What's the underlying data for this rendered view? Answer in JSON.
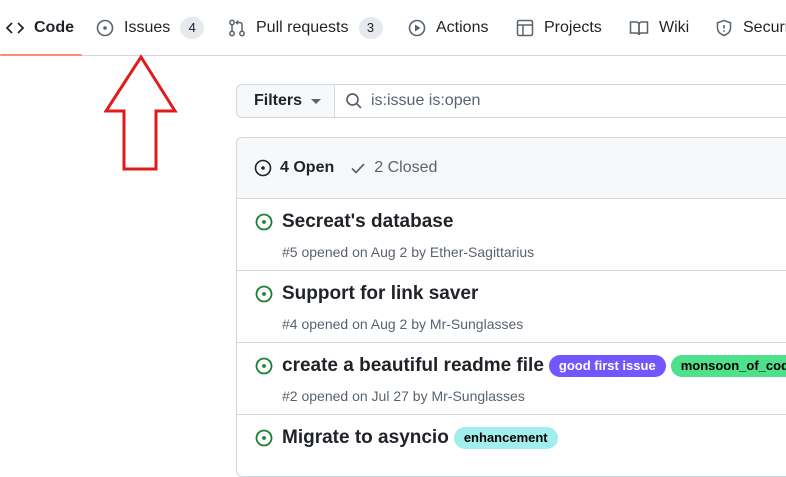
{
  "nav": {
    "code": "Code",
    "issues": "Issues",
    "issues_count": "4",
    "pulls": "Pull requests",
    "pulls_count": "3",
    "actions": "Actions",
    "projects": "Projects",
    "wiki": "Wiki",
    "security": "Security"
  },
  "filters": {
    "label": "Filters"
  },
  "search": {
    "value": "is:issue is:open"
  },
  "list_header": {
    "open": "4 Open",
    "closed": "2 Closed"
  },
  "issues": [
    {
      "title": "Secreat's database",
      "meta": "#5 opened on Aug 2 by Ether-Sagittarius",
      "labels": []
    },
    {
      "title": "Support for link saver",
      "meta": "#4 opened on Aug 2 by Mr-Sunglasses",
      "labels": []
    },
    {
      "title": "create a beautiful readme file",
      "meta": "#2 opened on Jul 27 by Mr-Sunglasses",
      "labels": [
        {
          "name": "good first issue",
          "bg": "#7057ff",
          "fg": "#ffffff"
        },
        {
          "name": "monsoon_of_code",
          "bg": "#4ee08a",
          "fg": "#000000"
        }
      ]
    },
    {
      "title": "Migrate to asyncio",
      "meta": "",
      "labels": [
        {
          "name": "enhancement",
          "bg": "#a2eeef",
          "fg": "#000000"
        }
      ]
    }
  ],
  "colors": {
    "open_green": "#1a7f37",
    "selected_underline": "#fd8c73",
    "annotation_arrow": "#e01b1b"
  }
}
